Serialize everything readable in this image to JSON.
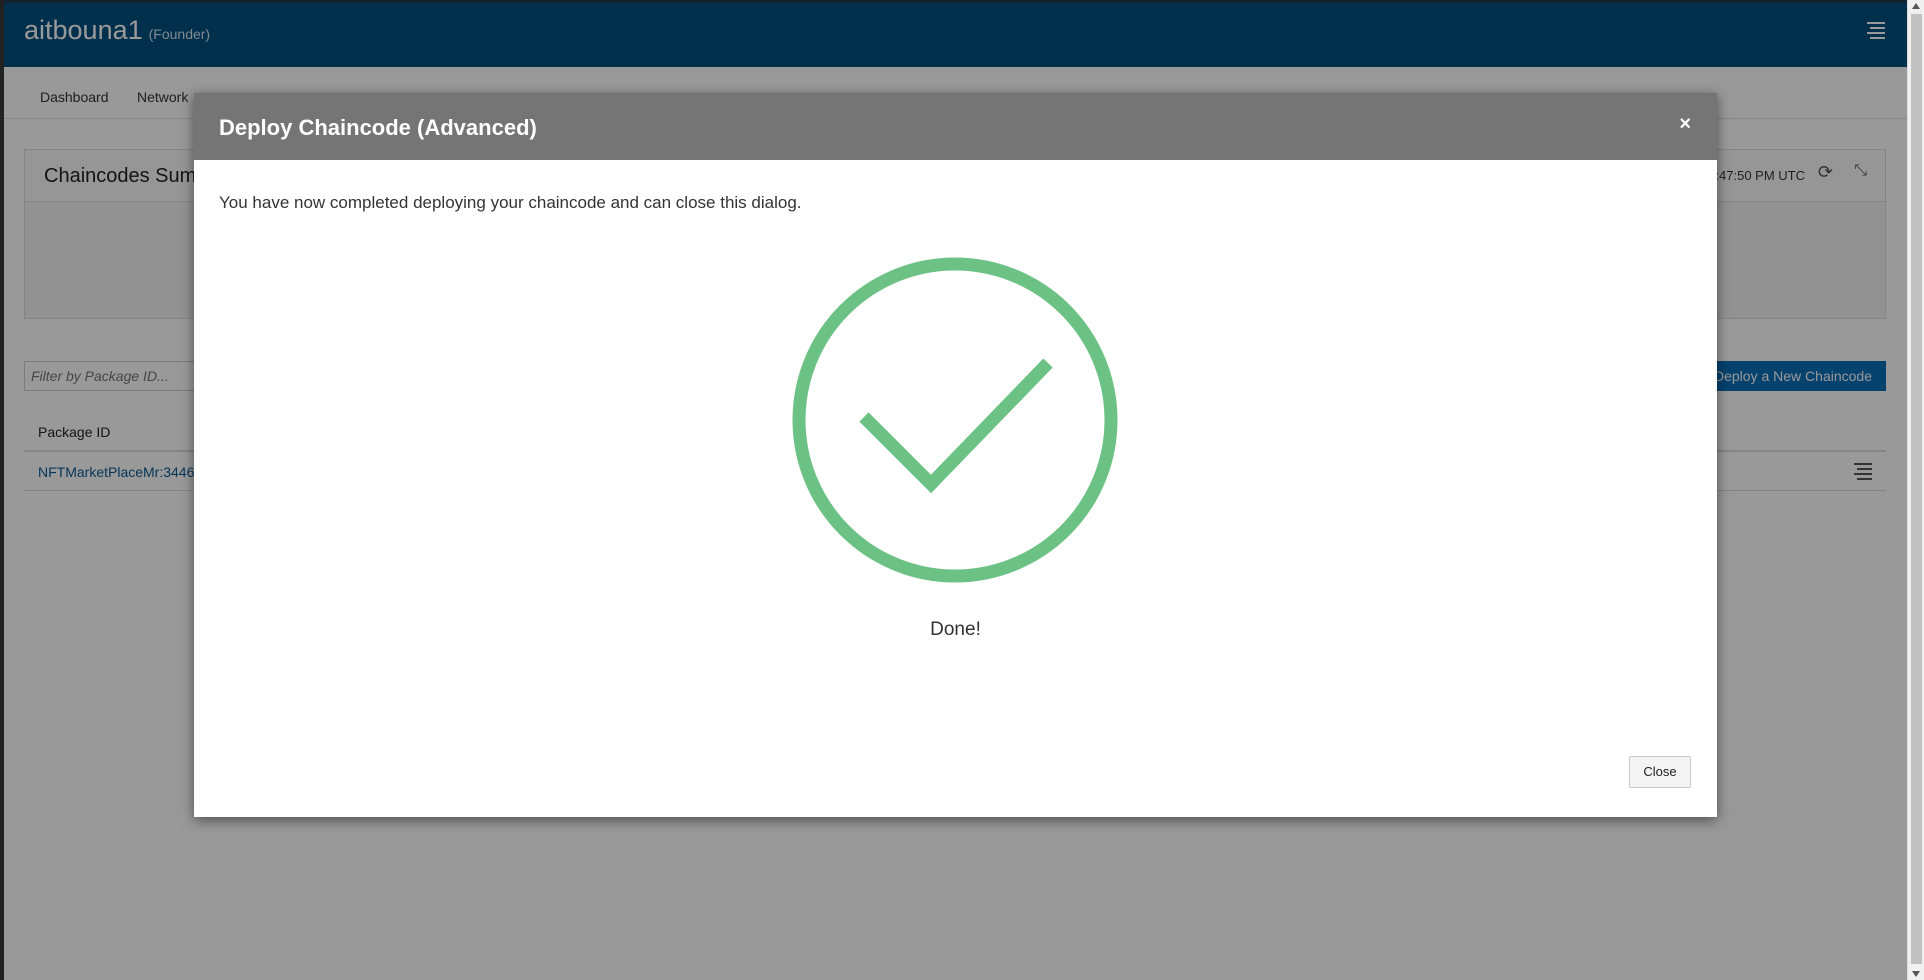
{
  "header": {
    "brand": "aitbouna1",
    "role": "(Founder)",
    "menu_icon": "hamburger-menu-icon"
  },
  "nav": {
    "items": [
      "Dashboard",
      "Network"
    ]
  },
  "summary_panel": {
    "title": "Chaincodes Sum",
    "refresh_time": ":47:50 PM UTC"
  },
  "filter": {
    "placeholder": "Filter by Package ID..."
  },
  "deploy_button": {
    "label": "Deploy a New Chaincode"
  },
  "table": {
    "columns": [
      "Package ID"
    ],
    "rows": [
      {
        "package_id": "NFTMarketPlaceMr:3446"
      }
    ]
  },
  "modal": {
    "title": "Deploy Chaincode (Advanced)",
    "close_symbol": "×",
    "message": "You have now completed deploying your chaincode and can close this dialog.",
    "status_text": "Done!",
    "close_label": "Close",
    "success_color": "#6cc284"
  },
  "colors": {
    "header_bg": "#00507f",
    "primary_button": "#0a6fb7",
    "modal_header_bg": "#757575"
  }
}
